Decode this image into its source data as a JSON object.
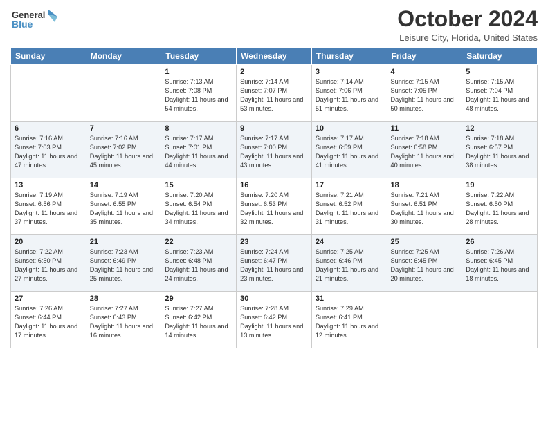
{
  "header": {
    "logo_line1": "General",
    "logo_line2": "Blue",
    "month": "October 2024",
    "location": "Leisure City, Florida, United States"
  },
  "weekdays": [
    "Sunday",
    "Monday",
    "Tuesday",
    "Wednesday",
    "Thursday",
    "Friday",
    "Saturday"
  ],
  "weeks": [
    [
      {
        "day": "",
        "sunrise": "",
        "sunset": "",
        "daylight": ""
      },
      {
        "day": "",
        "sunrise": "",
        "sunset": "",
        "daylight": ""
      },
      {
        "day": "1",
        "sunrise": "Sunrise: 7:13 AM",
        "sunset": "Sunset: 7:08 PM",
        "daylight": "Daylight: 11 hours and 54 minutes."
      },
      {
        "day": "2",
        "sunrise": "Sunrise: 7:14 AM",
        "sunset": "Sunset: 7:07 PM",
        "daylight": "Daylight: 11 hours and 53 minutes."
      },
      {
        "day": "3",
        "sunrise": "Sunrise: 7:14 AM",
        "sunset": "Sunset: 7:06 PM",
        "daylight": "Daylight: 11 hours and 51 minutes."
      },
      {
        "day": "4",
        "sunrise": "Sunrise: 7:15 AM",
        "sunset": "Sunset: 7:05 PM",
        "daylight": "Daylight: 11 hours and 50 minutes."
      },
      {
        "day": "5",
        "sunrise": "Sunrise: 7:15 AM",
        "sunset": "Sunset: 7:04 PM",
        "daylight": "Daylight: 11 hours and 48 minutes."
      }
    ],
    [
      {
        "day": "6",
        "sunrise": "Sunrise: 7:16 AM",
        "sunset": "Sunset: 7:03 PM",
        "daylight": "Daylight: 11 hours and 47 minutes."
      },
      {
        "day": "7",
        "sunrise": "Sunrise: 7:16 AM",
        "sunset": "Sunset: 7:02 PM",
        "daylight": "Daylight: 11 hours and 45 minutes."
      },
      {
        "day": "8",
        "sunrise": "Sunrise: 7:17 AM",
        "sunset": "Sunset: 7:01 PM",
        "daylight": "Daylight: 11 hours and 44 minutes."
      },
      {
        "day": "9",
        "sunrise": "Sunrise: 7:17 AM",
        "sunset": "Sunset: 7:00 PM",
        "daylight": "Daylight: 11 hours and 43 minutes."
      },
      {
        "day": "10",
        "sunrise": "Sunrise: 7:17 AM",
        "sunset": "Sunset: 6:59 PM",
        "daylight": "Daylight: 11 hours and 41 minutes."
      },
      {
        "day": "11",
        "sunrise": "Sunrise: 7:18 AM",
        "sunset": "Sunset: 6:58 PM",
        "daylight": "Daylight: 11 hours and 40 minutes."
      },
      {
        "day": "12",
        "sunrise": "Sunrise: 7:18 AM",
        "sunset": "Sunset: 6:57 PM",
        "daylight": "Daylight: 11 hours and 38 minutes."
      }
    ],
    [
      {
        "day": "13",
        "sunrise": "Sunrise: 7:19 AM",
        "sunset": "Sunset: 6:56 PM",
        "daylight": "Daylight: 11 hours and 37 minutes."
      },
      {
        "day": "14",
        "sunrise": "Sunrise: 7:19 AM",
        "sunset": "Sunset: 6:55 PM",
        "daylight": "Daylight: 11 hours and 35 minutes."
      },
      {
        "day": "15",
        "sunrise": "Sunrise: 7:20 AM",
        "sunset": "Sunset: 6:54 PM",
        "daylight": "Daylight: 11 hours and 34 minutes."
      },
      {
        "day": "16",
        "sunrise": "Sunrise: 7:20 AM",
        "sunset": "Sunset: 6:53 PM",
        "daylight": "Daylight: 11 hours and 32 minutes."
      },
      {
        "day": "17",
        "sunrise": "Sunrise: 7:21 AM",
        "sunset": "Sunset: 6:52 PM",
        "daylight": "Daylight: 11 hours and 31 minutes."
      },
      {
        "day": "18",
        "sunrise": "Sunrise: 7:21 AM",
        "sunset": "Sunset: 6:51 PM",
        "daylight": "Daylight: 11 hours and 30 minutes."
      },
      {
        "day": "19",
        "sunrise": "Sunrise: 7:22 AM",
        "sunset": "Sunset: 6:50 PM",
        "daylight": "Daylight: 11 hours and 28 minutes."
      }
    ],
    [
      {
        "day": "20",
        "sunrise": "Sunrise: 7:22 AM",
        "sunset": "Sunset: 6:50 PM",
        "daylight": "Daylight: 11 hours and 27 minutes."
      },
      {
        "day": "21",
        "sunrise": "Sunrise: 7:23 AM",
        "sunset": "Sunset: 6:49 PM",
        "daylight": "Daylight: 11 hours and 25 minutes."
      },
      {
        "day": "22",
        "sunrise": "Sunrise: 7:23 AM",
        "sunset": "Sunset: 6:48 PM",
        "daylight": "Daylight: 11 hours and 24 minutes."
      },
      {
        "day": "23",
        "sunrise": "Sunrise: 7:24 AM",
        "sunset": "Sunset: 6:47 PM",
        "daylight": "Daylight: 11 hours and 23 minutes."
      },
      {
        "day": "24",
        "sunrise": "Sunrise: 7:25 AM",
        "sunset": "Sunset: 6:46 PM",
        "daylight": "Daylight: 11 hours and 21 minutes."
      },
      {
        "day": "25",
        "sunrise": "Sunrise: 7:25 AM",
        "sunset": "Sunset: 6:45 PM",
        "daylight": "Daylight: 11 hours and 20 minutes."
      },
      {
        "day": "26",
        "sunrise": "Sunrise: 7:26 AM",
        "sunset": "Sunset: 6:45 PM",
        "daylight": "Daylight: 11 hours and 18 minutes."
      }
    ],
    [
      {
        "day": "27",
        "sunrise": "Sunrise: 7:26 AM",
        "sunset": "Sunset: 6:44 PM",
        "daylight": "Daylight: 11 hours and 17 minutes."
      },
      {
        "day": "28",
        "sunrise": "Sunrise: 7:27 AM",
        "sunset": "Sunset: 6:43 PM",
        "daylight": "Daylight: 11 hours and 16 minutes."
      },
      {
        "day": "29",
        "sunrise": "Sunrise: 7:27 AM",
        "sunset": "Sunset: 6:42 PM",
        "daylight": "Daylight: 11 hours and 14 minutes."
      },
      {
        "day": "30",
        "sunrise": "Sunrise: 7:28 AM",
        "sunset": "Sunset: 6:42 PM",
        "daylight": "Daylight: 11 hours and 13 minutes."
      },
      {
        "day": "31",
        "sunrise": "Sunrise: 7:29 AM",
        "sunset": "Sunset: 6:41 PM",
        "daylight": "Daylight: 11 hours and 12 minutes."
      },
      {
        "day": "",
        "sunrise": "",
        "sunset": "",
        "daylight": ""
      },
      {
        "day": "",
        "sunrise": "",
        "sunset": "",
        "daylight": ""
      }
    ]
  ]
}
